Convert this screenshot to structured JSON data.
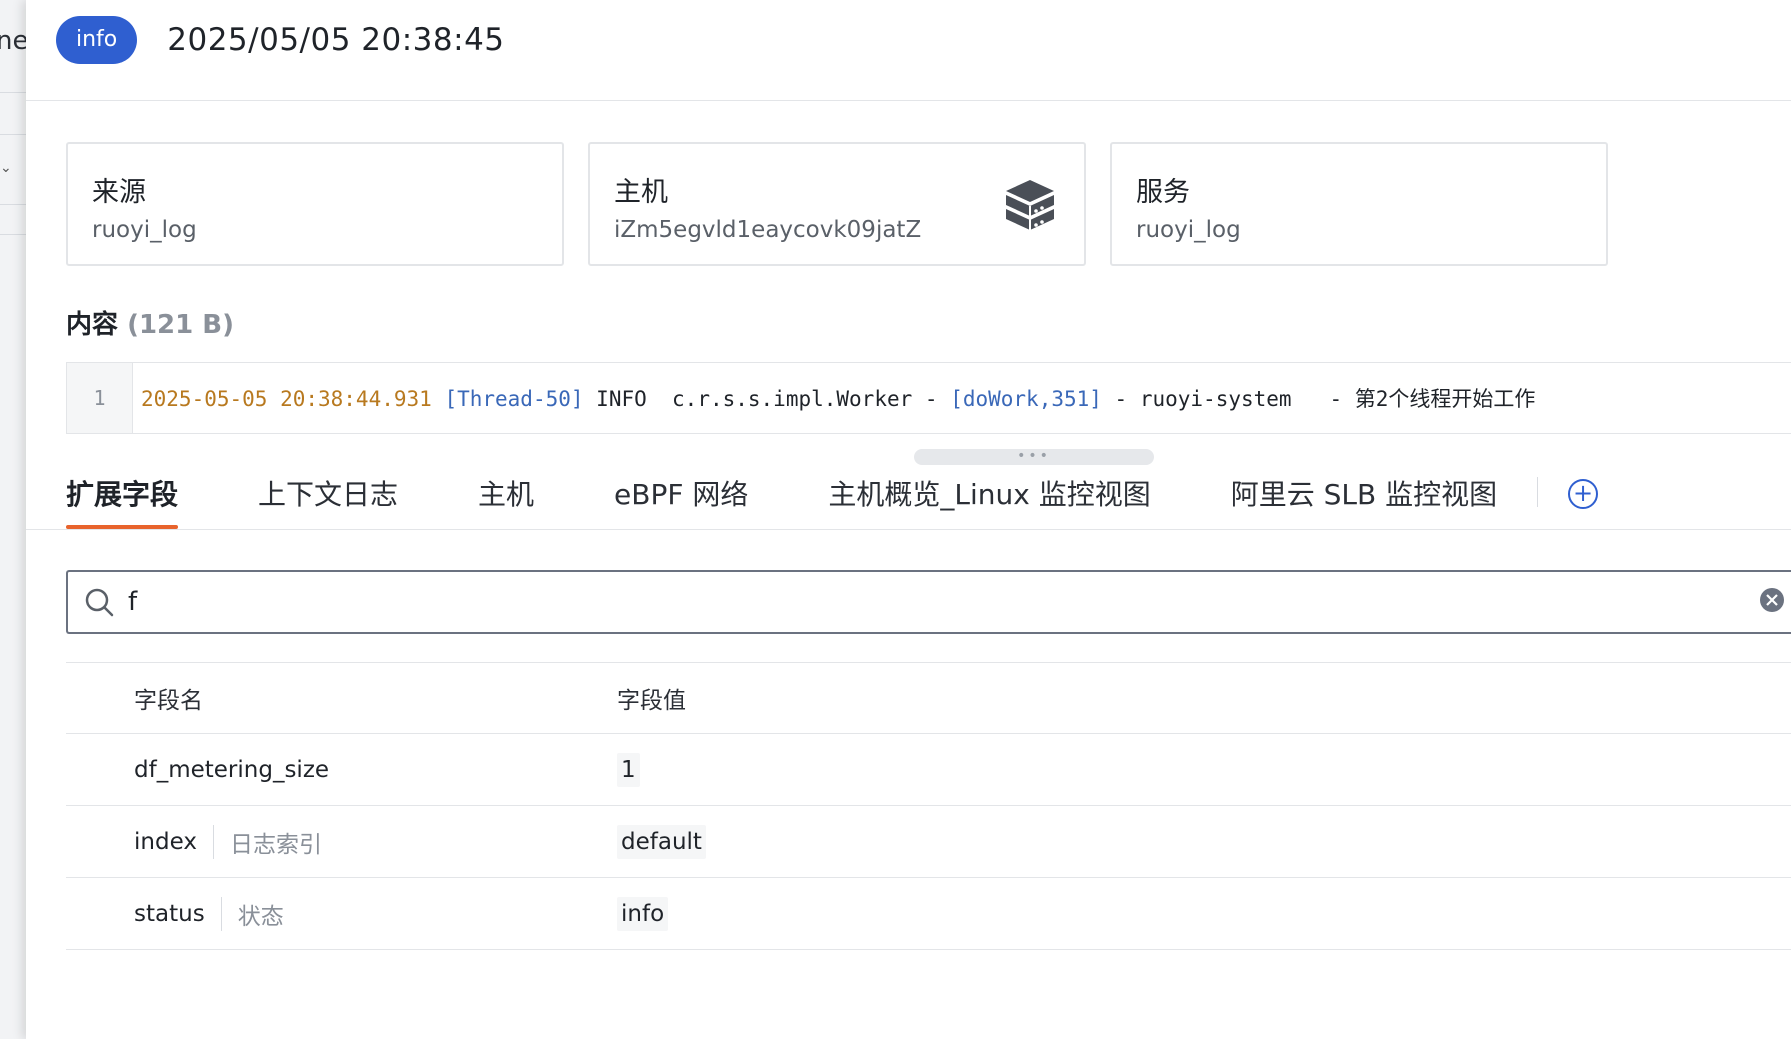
{
  "underlay": {
    "fragment": "ne"
  },
  "header": {
    "level_badge": "info",
    "timestamp": "2025/05/05 20:38:45"
  },
  "cards": [
    {
      "label": "来源",
      "value": "ruoyi_log"
    },
    {
      "label": "主机",
      "value": "iZm5egvld1eaycovk09jatZ",
      "icon": "server-stack-icon"
    },
    {
      "label": "服务",
      "value": "ruoyi_log"
    }
  ],
  "content": {
    "title": "内容",
    "size": "(121 B)",
    "line_number": "1",
    "timestamp_part": "2025-05-05 20:38:44.931",
    "thread_part": "[Thread-50]",
    "level_part": " INFO  c.r.s.s.impl.Worker - ",
    "method_part": "[doWork,351]",
    "tail_part": " - ruoyi-system   - 第2个线程开始工作"
  },
  "tabs": [
    {
      "label": "扩展字段",
      "active": true
    },
    {
      "label": "上下文日志",
      "active": false
    },
    {
      "label": "主机",
      "active": false
    },
    {
      "label": "eBPF 网络",
      "active": false
    },
    {
      "label": "主机概览_Linux 监控视图",
      "active": false
    },
    {
      "label": "阿里云 SLB 监控视图",
      "active": false
    }
  ],
  "search": {
    "value": "f",
    "icons": [
      "search-icon",
      "clear-icon"
    ]
  },
  "fields_table": {
    "headers": {
      "name": "字段名",
      "value": "字段值"
    },
    "rows": [
      {
        "name": "df_metering_size",
        "alias": "",
        "value": "1"
      },
      {
        "name": "index",
        "alias": "日志索引",
        "value": "default"
      },
      {
        "name": "status",
        "alias": "状态",
        "value": "info"
      }
    ]
  },
  "colors": {
    "accent": "#2f5fd0",
    "active_tab": "#e8632c"
  }
}
